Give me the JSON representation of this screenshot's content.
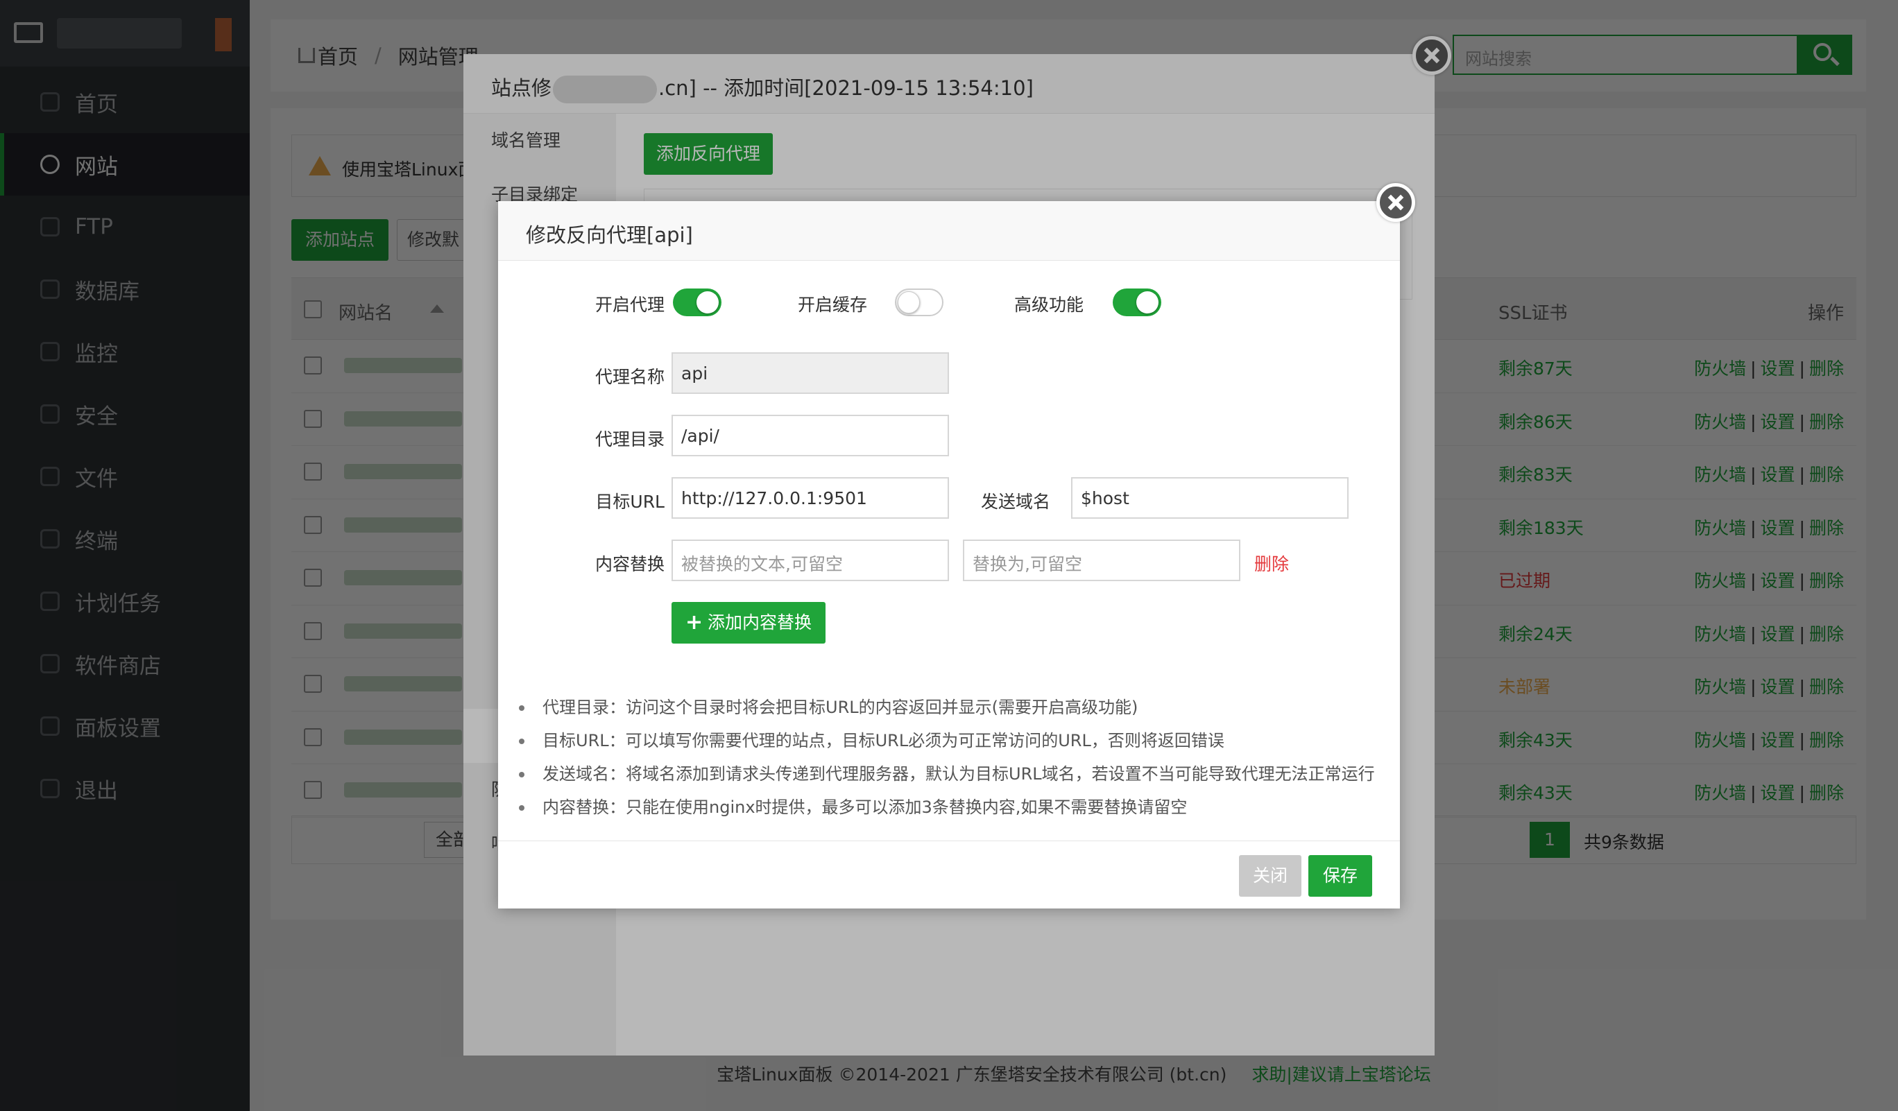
{
  "sidebar": {
    "items": [
      {
        "label": "首页",
        "icon": "home-icon"
      },
      {
        "label": "网站",
        "icon": "globe-icon",
        "active": true
      },
      {
        "label": "FTP",
        "icon": "ftp-icon"
      },
      {
        "label": "数据库",
        "icon": "database-icon"
      },
      {
        "label": "监控",
        "icon": "monitor-icon"
      },
      {
        "label": "安全",
        "icon": "shield-icon"
      },
      {
        "label": "文件",
        "icon": "folder-icon"
      },
      {
        "label": "终端",
        "icon": "terminal-icon"
      },
      {
        "label": "计划任务",
        "icon": "calendar-icon"
      },
      {
        "label": "软件商店",
        "icon": "apps-icon"
      },
      {
        "label": "面板设置",
        "icon": "gear-icon"
      },
      {
        "label": "退出",
        "icon": "logout-icon"
      }
    ]
  },
  "header": {
    "breadcrumb_home": "首页",
    "breadcrumb_sep": "/",
    "breadcrumb_current": "网站管理",
    "search_placeholder": "网站搜索"
  },
  "page": {
    "warning_text": "使用宝塔Linux面",
    "add_site_label": "添加站点",
    "modify_label": "修改默",
    "table_headers": {
      "name": "网站名",
      "ssl": "SSL证书",
      "ops": "操作"
    },
    "rows": [
      {
        "ssl": "剩余87天",
        "ssl_color": "#20a53a"
      },
      {
        "ssl": "剩余86天",
        "ssl_color": "#20a53a"
      },
      {
        "ssl": "剩余83天",
        "ssl_color": "#20a53a"
      },
      {
        "ssl": "剩余183天",
        "ssl_color": "#20a53a"
      },
      {
        "ssl": "已过期",
        "ssl_color": "#e4393c"
      },
      {
        "ssl": "剩余24天",
        "ssl_color": "#20a53a"
      },
      {
        "ssl": "未部署",
        "ssl_color": "#f0ad4e"
      },
      {
        "ssl": "剩余43天",
        "ssl_color": "#20a53a"
      },
      {
        "ssl": "剩余43天",
        "ssl_color": "#20a53a"
      }
    ],
    "row_ops": {
      "firewall": "防火墙",
      "settings": "设置",
      "delete": "删除",
      "sep": "|"
    },
    "pager": {
      "left_select": "全部分",
      "page": "1",
      "total": "共9条数据"
    }
  },
  "footer": {
    "copyright": "宝塔Linux面板 ©2014-2021 广东堡塔安全技术有限公司 (bt.cn)",
    "link": "求助|建议请上宝塔论坛"
  },
  "site_modal": {
    "title_prefix": "站点修",
    "title_suffix": ".cn] -- 添加时间[2021-09-15 13:54:10]",
    "nav": [
      "域名管理",
      "子目录绑定",
      "",
      "",
      "",
      "",
      "",
      "",
      "",
      "",
      "",
      "",
      "防盗链",
      "响应日志"
    ],
    "add_proxy_label": "添加反向代理"
  },
  "proxy_modal": {
    "title": "修改反向代理[api]",
    "toggles": [
      {
        "label": "开启代理",
        "on": true
      },
      {
        "label": "开启缓存",
        "on": false
      },
      {
        "label": "高级功能",
        "on": true
      }
    ],
    "proxy_name_label": "代理名称",
    "proxy_name_value": "api",
    "proxy_dir_label": "代理目录",
    "proxy_dir_value": "/api/",
    "target_url_label": "目标URL",
    "target_url_value": "http://127.0.0.1:9501",
    "send_domain_label": "发送域名",
    "send_domain_value": "$host",
    "replace_label": "内容替换",
    "replace_from_placeholder": "被替换的文本,可留空",
    "replace_to_placeholder": "替换为,可留空",
    "delete_label": "删除",
    "add_replace_label": "添加内容替换",
    "tips": [
      "代理目录：访问这个目录时将会把目标URL的内容返回并显示(需要开启高级功能)",
      "目标URL：可以填写你需要代理的站点，目标URL必须为可正常访问的URL，否则将返回错误",
      "发送域名：将域名添加到请求头传递到代理服务器，默认为目标URL域名，若设置不当可能导致代理无法正常运行",
      "内容替换：只能在使用nginx时提供，最多可以添加3条替换内容,如果不需要替换请留空"
    ],
    "close_label": "关闭",
    "save_label": "保存"
  },
  "colors": {
    "accent": "#20a53a",
    "danger": "#e4393c",
    "warning": "#f0ad4e",
    "sidebar": "#2f3236"
  }
}
